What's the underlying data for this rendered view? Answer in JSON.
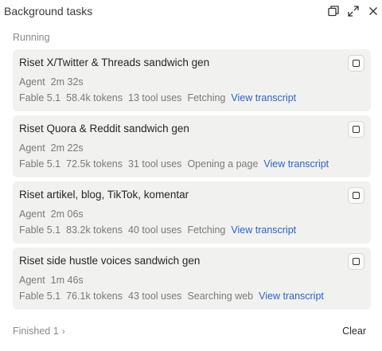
{
  "panel": {
    "title": "Background tasks",
    "section_running": "Running",
    "finished_label": "Finished 1",
    "clear_label": "Clear"
  },
  "header_icons": [
    "popout-icon",
    "expand-icon",
    "close-icon"
  ],
  "tasks": [
    {
      "title": "Riset X/Twitter & Threads sandwich gen",
      "agent": "Agent",
      "duration": "2m 32s",
      "model": "Fable 5.1",
      "tokens": "58.4k tokens",
      "tools": "13 tool uses",
      "status": "Fetching",
      "link": "View transcript"
    },
    {
      "title": "Riset Quora & Reddit sandwich gen",
      "agent": "Agent",
      "duration": "2m 22s",
      "model": "Fable 5.1",
      "tokens": "72.5k tokens",
      "tools": "31 tool uses",
      "status": "Opening a page",
      "link": "View transcript"
    },
    {
      "title": "Riset artikel, blog, TikTok, komentar",
      "agent": "Agent",
      "duration": "2m 06s",
      "model": "Fable 5.1",
      "tokens": "83.2k tokens",
      "tools": "40 tool uses",
      "status": "Fetching",
      "link": "View transcript"
    },
    {
      "title": "Riset side hustle voices sandwich gen",
      "agent": "Agent",
      "duration": "1m 46s",
      "model": "Fable 5.1",
      "tokens": "76.1k tokens",
      "tools": "43 tool uses",
      "status": "Searching web",
      "link": "View transcript"
    }
  ],
  "colors": {
    "link": "#2c63c9",
    "card_bg": "#f1f1ef",
    "muted": "#7a7a7a"
  }
}
